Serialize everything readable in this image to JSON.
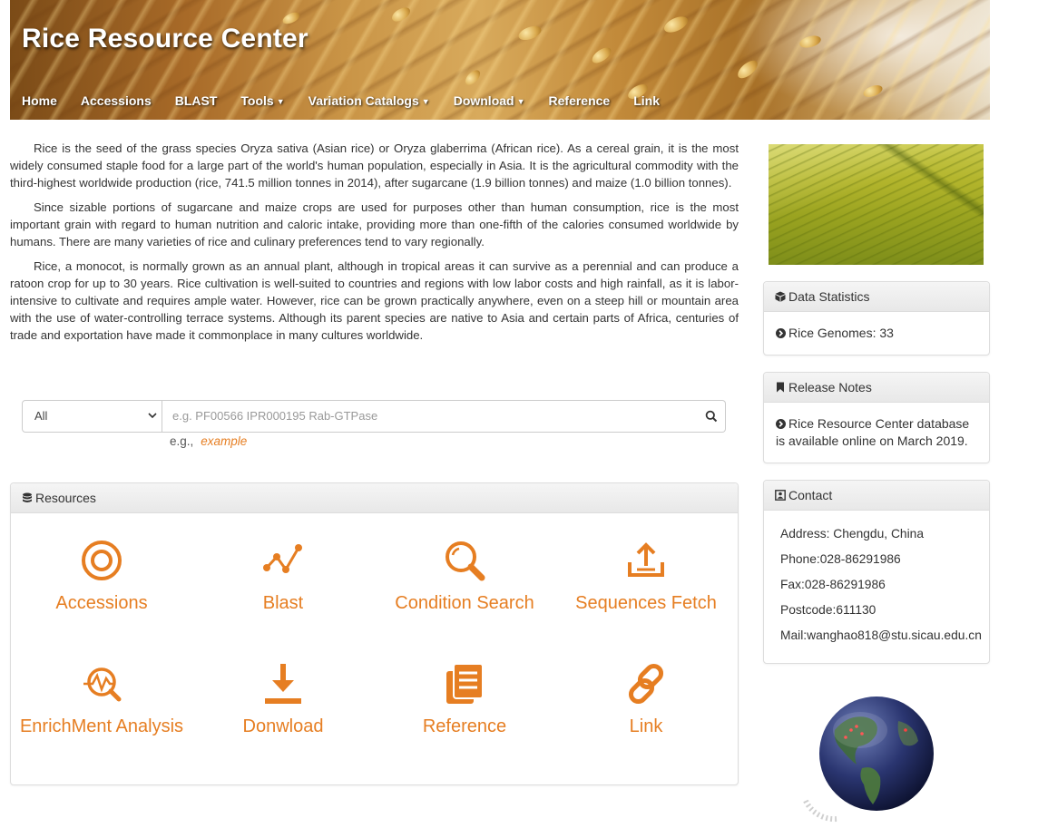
{
  "header": {
    "title": "Rice Resource Center",
    "nav": [
      {
        "label": "Home",
        "dropdown": false
      },
      {
        "label": "Accessions",
        "dropdown": false
      },
      {
        "label": "BLAST",
        "dropdown": false
      },
      {
        "label": "Tools",
        "dropdown": true
      },
      {
        "label": "Variation Catalogs",
        "dropdown": true
      },
      {
        "label": "Download",
        "dropdown": true
      },
      {
        "label": "Reference",
        "dropdown": false
      },
      {
        "label": "Link",
        "dropdown": false
      }
    ]
  },
  "intro": {
    "paragraphs": [
      "Rice is the seed of the grass species Oryza sativa (Asian rice) or Oryza glaberrima (African rice). As a cereal grain, it is the most widely consumed staple food for a large part of the world's human population, especially in Asia. It is the agricultural commodity with the third-highest worldwide production (rice, 741.5 million tonnes in 2014), after sugarcane (1.9 billion tonnes) and maize (1.0 billion tonnes).",
      "Since sizable portions of sugarcane and maize crops are used for purposes other than human consumption, rice is the most important grain with regard to human nutrition and caloric intake, providing more than one-fifth of the calories consumed worldwide by humans. There are many varieties of rice and culinary preferences tend to vary regionally.",
      "Rice, a monocot, is normally grown as an annual plant, although in tropical areas it can survive as a perennial and can produce a ratoon crop for up to 30 years. Rice cultivation is well-suited to countries and regions with low labor costs and high rainfall, as it is labor-intensive to cultivate and requires ample water. However, rice can be grown practically anywhere, even on a steep hill or mountain area with the use of water-controlling terrace systems. Although its parent species are native to Asia and certain parts of Africa, centuries of trade and exportation have made it commonplace in many cultures worldwide."
    ]
  },
  "search": {
    "select_value": "All",
    "placeholder": "e.g. PF00566 IPR000195 Rab-GTPase",
    "hint_prefix": "e.g.,",
    "hint_example": "example"
  },
  "resources": {
    "title": "Resources",
    "items": [
      {
        "label": "Accessions",
        "icon": "target-icon"
      },
      {
        "label": "Blast",
        "icon": "line-chart-icon"
      },
      {
        "label": "Condition Search",
        "icon": "magnifier-icon"
      },
      {
        "label": "Sequences Fetch",
        "icon": "upload-icon"
      },
      {
        "label": "EnrichMent Analysis",
        "icon": "analysis-icon"
      },
      {
        "label": "Donwload",
        "icon": "download-icon"
      },
      {
        "label": "Reference",
        "icon": "documents-icon"
      },
      {
        "label": "Link",
        "icon": "link-icon"
      }
    ]
  },
  "sidebar": {
    "stats": {
      "title": "Data Statistics",
      "item": "Rice Genomes: 33"
    },
    "release": {
      "title": "Release Notes",
      "item": "Rice Resource Center database is available online on March 2019."
    },
    "contact": {
      "title": "Contact",
      "address": "Address: Chengdu, China",
      "phone": "Phone:028-86291986",
      "fax": "Fax:028-86291986",
      "postcode": "Postcode:611130",
      "mail": "Mail:wanghao818@stu.sicau.edu.cn"
    }
  },
  "colors": {
    "accent": "#e67e22",
    "text": "#333333",
    "panel_head": "#eeeeee"
  }
}
